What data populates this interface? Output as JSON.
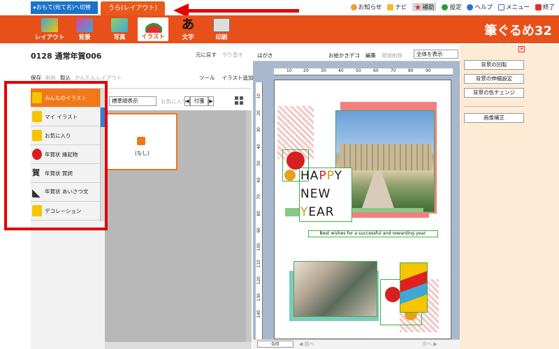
{
  "tabs": {
    "front": "▸おもて(宛て名)へ切替",
    "back": "うら(レイアウト)"
  },
  "top_menu": {
    "news": "お知らせ",
    "navi": "ナビ",
    "hojo": "補助",
    "settings": "設定",
    "help": "ヘルプ",
    "menu": "メニュー",
    "exit": "終了"
  },
  "toolbar": {
    "layout": "レイアウト",
    "background": "背景",
    "photo": "写真",
    "illust": "イラスト",
    "text": "文字",
    "text_glyph": "あ",
    "print": "印刷",
    "brand": "筆ぐるめ32"
  },
  "left_panel": {
    "doc_title": "0128 通常年賀006",
    "undo": "元に戻す",
    "redo": "やり直す",
    "save": "保存",
    "delete": "削除",
    "import": "取込",
    "easy_layout": "かんたんレイアウト",
    "tool": "ツール",
    "add_illust": "イラスト追加",
    "categories": [
      {
        "label": "みんなのイラスト"
      },
      {
        "label": "マイ イラスト"
      },
      {
        "label": "お気に入り"
      },
      {
        "label": "年賀状 縁起物"
      },
      {
        "label": "年賀状 賀詞"
      },
      {
        "label": "年賀状 あいさつ文"
      },
      {
        "label": "デコレーション"
      }
    ],
    "category_glyph_gashi": "賀"
  },
  "gallery": {
    "sort": "標準順表示",
    "favorites": "お気に入り",
    "date_nav": "付箋",
    "none_item": "(なし)"
  },
  "canvas_header": {
    "paper_type": "はがき",
    "deco": "お絵かきデコ",
    "edit": "編集",
    "area_delete": "領域削除",
    "zoom": "全体を表示"
  },
  "ruler": {
    "top": [
      "10",
      "20",
      "30",
      "40",
      "50",
      "60",
      "70",
      "80",
      "90"
    ],
    "left": [
      "10",
      "20",
      "30",
      "40",
      "50",
      "60",
      "70",
      "80",
      "90",
      "100",
      "110",
      "120",
      "130",
      "140"
    ]
  },
  "card": {
    "line1": [
      "H",
      "A",
      "P",
      "P",
      "Y"
    ],
    "line2": [
      "N",
      "E",
      "W"
    ],
    "line3": [
      "Y",
      "E",
      "A",
      "R"
    ],
    "tagline": "Best wishes for a successful and rewarding year.",
    "letter_colors": {
      "black": "#1a1a1a",
      "red": "#d62020",
      "gold": "#c8961a"
    }
  },
  "canvas_footer": {
    "page": "0/0",
    "prev": "◀ 前へ",
    "next": "次へ ▶"
  },
  "right_panel": {
    "rotate": "背景の回転",
    "stretch": "背景の伸縮設定",
    "color_change": "背景の色チェンジ",
    "image_correct": "画像補正",
    "close": "×"
  },
  "colors": {
    "accent_orange": "#e8501a",
    "tab_blue": "#1a73c9",
    "highlight_red": "#e00000",
    "right_panel_bg": "#fdebd6"
  }
}
